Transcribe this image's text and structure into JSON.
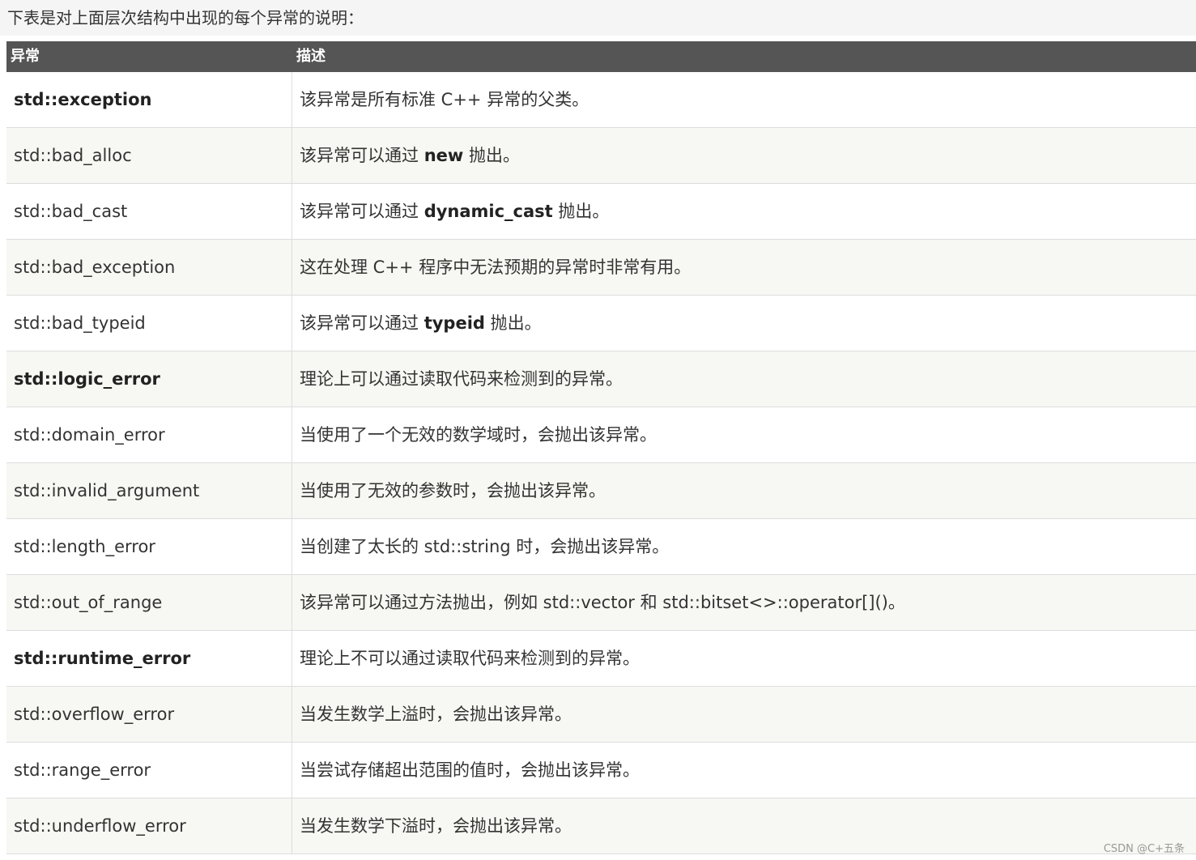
{
  "intro": "下表是对上面层次结构中出现的每个异常的说明：",
  "table": {
    "headers": [
      "异常",
      "描述"
    ],
    "rows": [
      {
        "name": "std::exception",
        "bold": true,
        "desc_pre": "该异常是所有标准 C++ 异常的父类。",
        "kw": "",
        "desc_post": ""
      },
      {
        "name": "std::bad_alloc",
        "bold": false,
        "desc_pre": "该异常可以通过 ",
        "kw": "new",
        "desc_post": " 抛出。"
      },
      {
        "name": "std::bad_cast",
        "bold": false,
        "desc_pre": "该异常可以通过 ",
        "kw": "dynamic_cast",
        "desc_post": " 抛出。"
      },
      {
        "name": "std::bad_exception",
        "bold": false,
        "desc_pre": "这在处理 C++ 程序中无法预期的异常时非常有用。",
        "kw": "",
        "desc_post": ""
      },
      {
        "name": "std::bad_typeid",
        "bold": false,
        "desc_pre": "该异常可以通过 ",
        "kw": "typeid",
        "desc_post": " 抛出。"
      },
      {
        "name": "std::logic_error",
        "bold": true,
        "desc_pre": "理论上可以通过读取代码来检测到的异常。",
        "kw": "",
        "desc_post": ""
      },
      {
        "name": "std::domain_error",
        "bold": false,
        "desc_pre": "当使用了一个无效的数学域时，会抛出该异常。",
        "kw": "",
        "desc_post": ""
      },
      {
        "name": "std::invalid_argument",
        "bold": false,
        "desc_pre": "当使用了无效的参数时，会抛出该异常。",
        "kw": "",
        "desc_post": ""
      },
      {
        "name": "std::length_error",
        "bold": false,
        "desc_pre": "当创建了太长的 std::string 时，会抛出该异常。",
        "kw": "",
        "desc_post": ""
      },
      {
        "name": "std::out_of_range",
        "bold": false,
        "desc_pre": "该异常可以通过方法抛出，例如 std::vector 和 std::bitset<>::operator[]()。",
        "kw": "",
        "desc_post": ""
      },
      {
        "name": "std::runtime_error",
        "bold": true,
        "desc_pre": "理论上不可以通过读取代码来检测到的异常。",
        "kw": "",
        "desc_post": ""
      },
      {
        "name": "std::overflow_error",
        "bold": false,
        "desc_pre": "当发生数学上溢时，会抛出该异常。",
        "kw": "",
        "desc_post": ""
      },
      {
        "name": "std::range_error",
        "bold": false,
        "desc_pre": "当尝试存储超出范围的值时，会抛出该异常。",
        "kw": "",
        "desc_post": ""
      },
      {
        "name": "std::underflow_error",
        "bold": false,
        "desc_pre": "当发生数学下溢时，会抛出该异常。",
        "kw": "",
        "desc_post": ""
      }
    ]
  },
  "watermark": "CSDN @C+五条"
}
